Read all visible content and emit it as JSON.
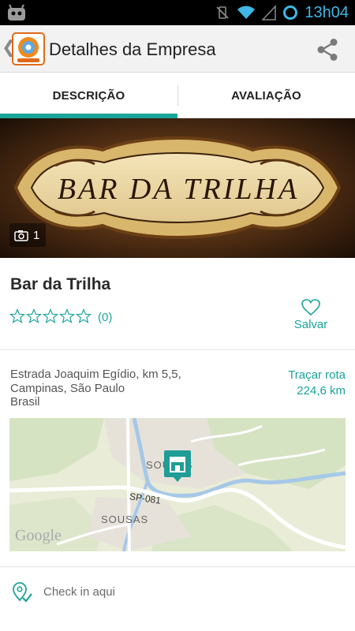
{
  "status_bar": {
    "time": "13h04",
    "icons": [
      "android-robot-icon",
      "vibrate-off-icon",
      "wifi-icon",
      "signal-icon",
      "circle-ring-icon"
    ]
  },
  "action_bar": {
    "back_icon": "chevron-left-icon",
    "logo_icon": "app-logo-icon",
    "title": "Detalhes da Empresa",
    "share_icon": "share-icon"
  },
  "tabs": [
    {
      "label": "DESCRIÇÃO",
      "selected": true
    },
    {
      "label": "AVALIAÇÃO",
      "selected": false
    }
  ],
  "colors": {
    "accent": "#1aa49a",
    "text_dark": "#2a2a2a",
    "text_gray": "#555555"
  },
  "banner": {
    "sign_text": "BAR DA TRILHA",
    "photo_count": "1",
    "camera_icon": "camera-icon"
  },
  "business": {
    "name": "Bar da Trilha",
    "rating_stars": 0,
    "max_stars": 5,
    "rating_count": "(0)",
    "save_label": "Salvar",
    "save_icon": "heart-outline-icon"
  },
  "address": {
    "line1": "Estrada Joaquim Egídio, km 5,5,",
    "line2": "Campinas, São Paulo",
    "line3": "Brasil",
    "route_label": "Traçar rota",
    "distance": "224,6 km"
  },
  "map": {
    "labels": {
      "souzas": "SOUZAS",
      "sousas": "SOUSAS",
      "road": "SP-081"
    },
    "watermark": "Google",
    "marker_icon": "store-marker-icon"
  },
  "checkin": {
    "label": "Check in aqui",
    "icon": "checkin-pin-icon"
  }
}
